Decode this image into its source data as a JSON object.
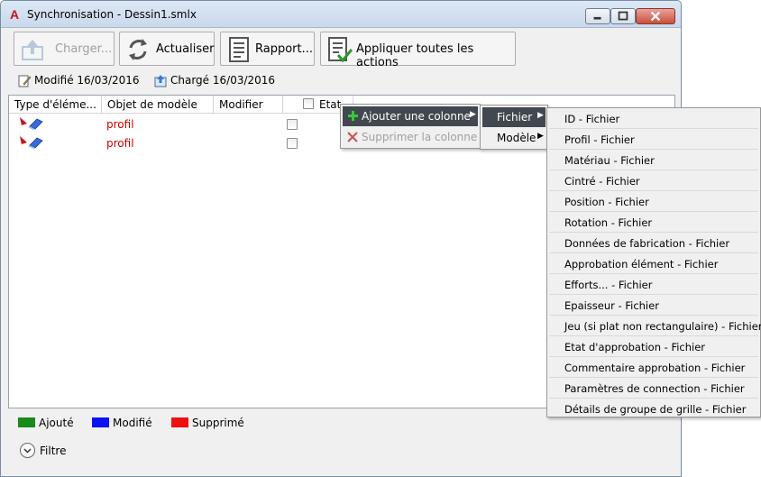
{
  "window": {
    "title": "Synchronisation - Dessin1.smlx",
    "app_icon": "A"
  },
  "toolbar": {
    "charger_label": "Charger...",
    "actualiser_label": "Actualiser",
    "rapport_label": "Rapport...",
    "appliquer_label": "Appliquer toutes les actions"
  },
  "info": {
    "modifie": "Modifié 16/03/2016",
    "charge": "Chargé 16/03/2016"
  },
  "grid": {
    "columns": [
      "Type d'éléme...",
      "Objet de modèle",
      "Modifier",
      "Etat"
    ],
    "rows": [
      {
        "objet": "profil"
      },
      {
        "objet": "profil"
      }
    ]
  },
  "legend": {
    "items": [
      {
        "label": "Ajouté",
        "color": "#1a8a1a"
      },
      {
        "label": "Modifié",
        "color": "#0a14f0"
      },
      {
        "label": "Supprimé",
        "color": "#f01010"
      }
    ]
  },
  "filtre_label": "Filtre",
  "context_menu": {
    "items": [
      {
        "label": "Ajouter une colonne",
        "icon": "plus-icon"
      },
      {
        "label": "Supprimer la colonne",
        "icon": "x-icon"
      }
    ]
  },
  "submenu": {
    "items": [
      {
        "label": "Fichier"
      },
      {
        "label": "Modèle"
      }
    ]
  },
  "fichier_menu": {
    "items": [
      "ID - Fichier",
      "Profil - Fichier",
      "Matériau - Fichier",
      "Cintré - Fichier",
      "Position - Fichier",
      "Rotation - Fichier",
      "Données de fabrication - Fichier",
      "Approbation élément - Fichier",
      "Efforts... - Fichier",
      "Epaisseur - Fichier",
      "Jeu (si plat non rectangulaire) - Fichier",
      "Etat d'approbation - Fichier",
      "Commentaire approbation - Fichier",
      "Paramètres de connection - Fichier",
      "Détails de groupe de grille - Fichier"
    ]
  },
  "colors": {
    "profil_text": "#d40000",
    "menu_highlight": "#42484f"
  }
}
